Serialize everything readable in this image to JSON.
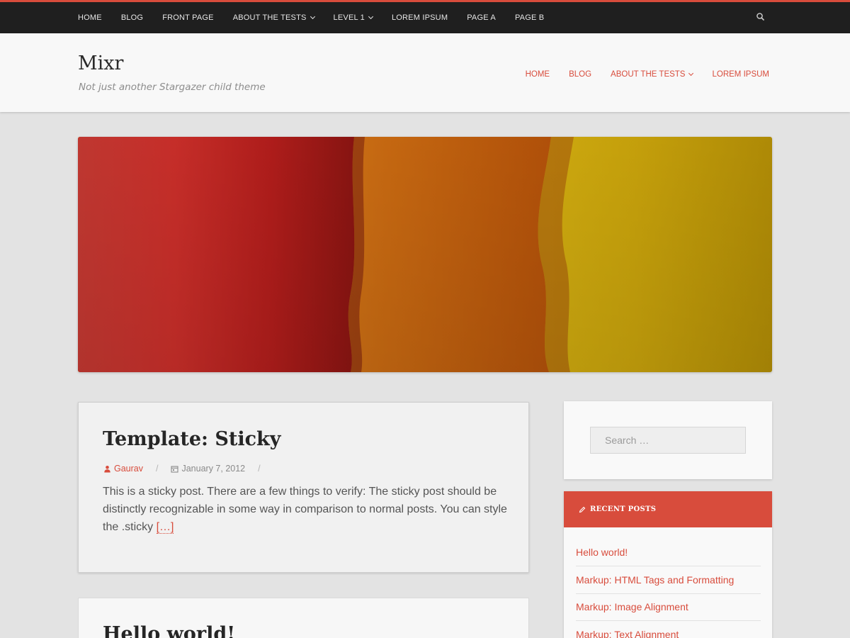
{
  "topnav": {
    "items": [
      {
        "label": "HOME"
      },
      {
        "label": "BLOG"
      },
      {
        "label": "FRONT PAGE"
      },
      {
        "label": "ABOUT THE TESTS"
      },
      {
        "label": "LEVEL 1"
      },
      {
        "label": "LOREM IPSUM"
      },
      {
        "label": "PAGE A"
      },
      {
        "label": "PAGE B"
      }
    ],
    "search_icon": "search-icon"
  },
  "site": {
    "title": "Mixr",
    "description": "Not just another Stargazer child theme"
  },
  "header_nav": {
    "items": [
      {
        "label": "HOME"
      },
      {
        "label": "BLOG"
      },
      {
        "label": "ABOUT THE TESTS"
      },
      {
        "label": "LOREM IPSUM"
      }
    ]
  },
  "posts": [
    {
      "title": "Template: Sticky",
      "author": "Gaurav",
      "date": "January 7, 2012",
      "meta_separator": "/",
      "excerpt": "This is a sticky post. There are a few things to verify: The sticky post should be distinctly recognizable in some way in comparison to normal posts. You can style the .sticky",
      "more": "[…]"
    },
    {
      "title": "Hello world!"
    }
  ],
  "sidebar": {
    "search_placeholder": "Search …",
    "recent_posts": {
      "title": "RECENT POSTS",
      "items": [
        {
          "label": "Hello world!"
        },
        {
          "label": "Markup: HTML Tags and Formatting"
        },
        {
          "label": "Markup: Image Alignment"
        },
        {
          "label": "Markup: Text Alignment"
        }
      ]
    }
  },
  "colors": {
    "accent": "#d84c3c",
    "topbar": "#1f1f1f",
    "background": "#e3e3e3"
  }
}
